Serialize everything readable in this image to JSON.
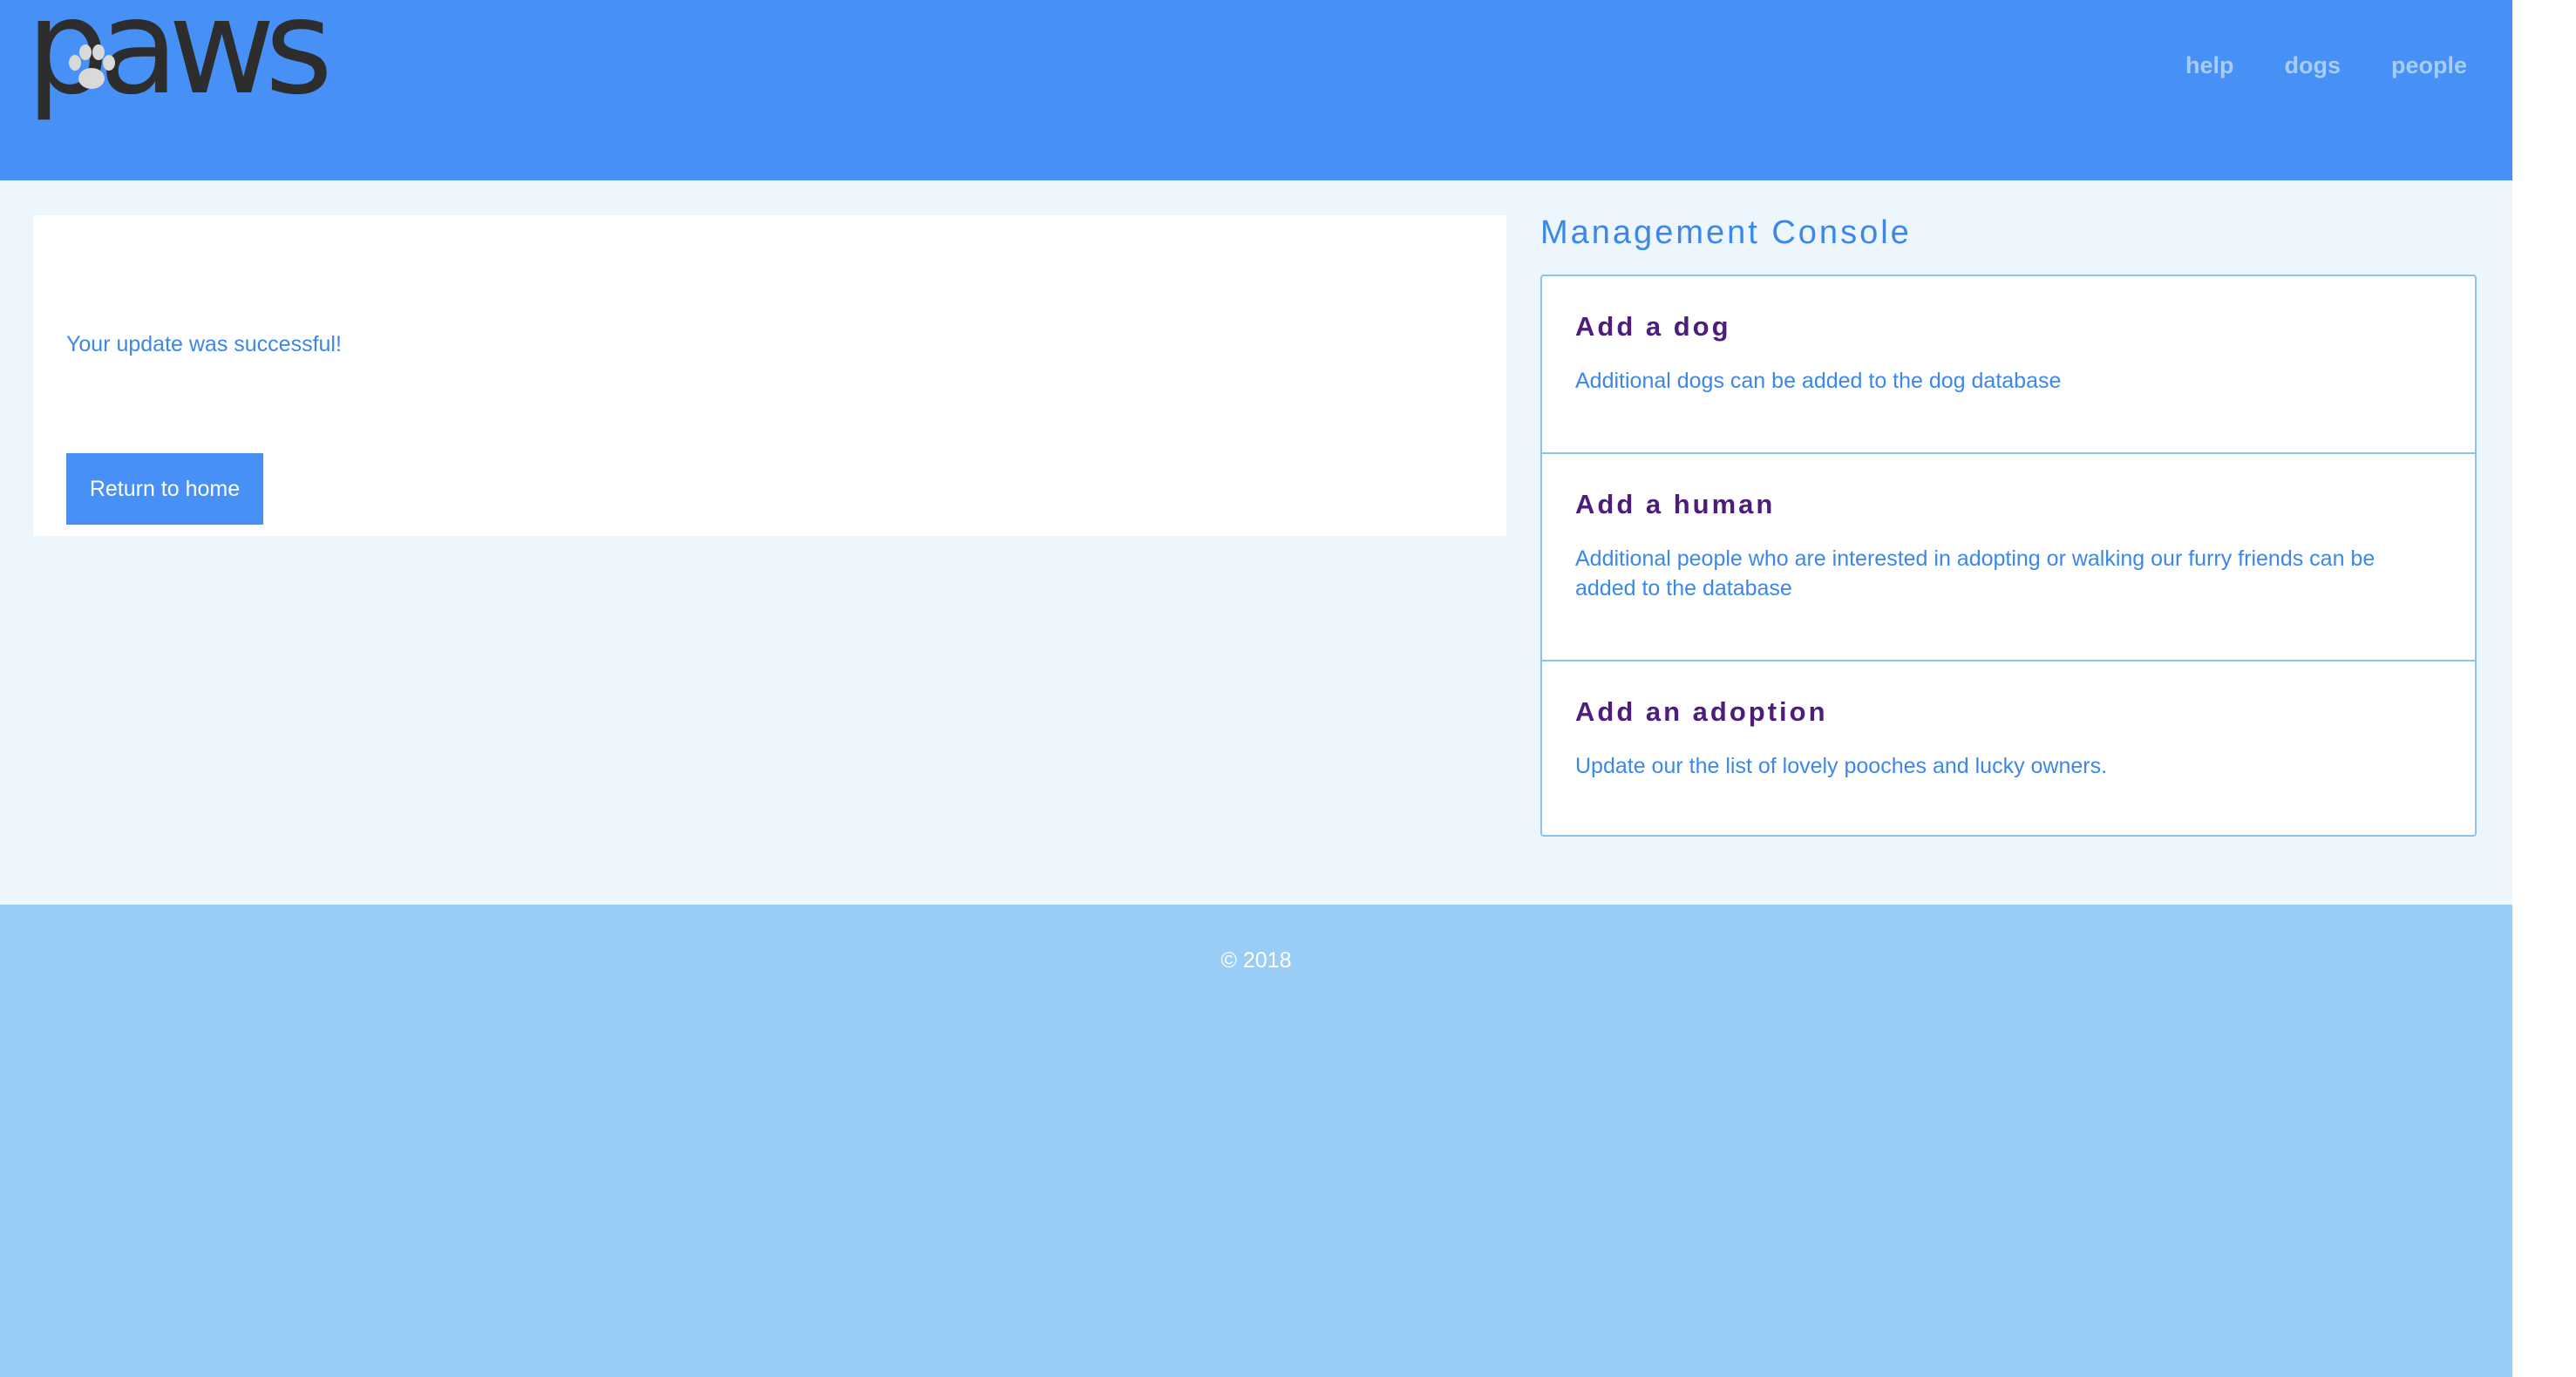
{
  "header": {
    "logo_text": "paws",
    "nav": {
      "help": "help",
      "dogs": "dogs",
      "people": "people"
    }
  },
  "main": {
    "message": "Your update was successful!",
    "return_label": "Return to home"
  },
  "console": {
    "title": "Management Console",
    "items": [
      {
        "title": "Add a dog",
        "description": "Additional dogs can be added to the dog database"
      },
      {
        "title": "Add a human",
        "description": "Additional people who are interested in adopting or walking our furry friends can be added to the database"
      },
      {
        "title": "Add an adoption",
        "description": "Update our the list of lovely pooches and lucky owners."
      }
    ]
  },
  "footer": {
    "copyright": "© 2018"
  },
  "colors": {
    "header_bg": "#4690f6",
    "page_bg": "#eef6fd",
    "footer_bg": "#99cdf6",
    "accent_text": "#3b87ea",
    "item_title": "#4c1d7e",
    "nav_link": "#a8cdf3",
    "logo": "#2d2d2d"
  },
  "icons": {
    "logo_paw": "paw-icon"
  }
}
